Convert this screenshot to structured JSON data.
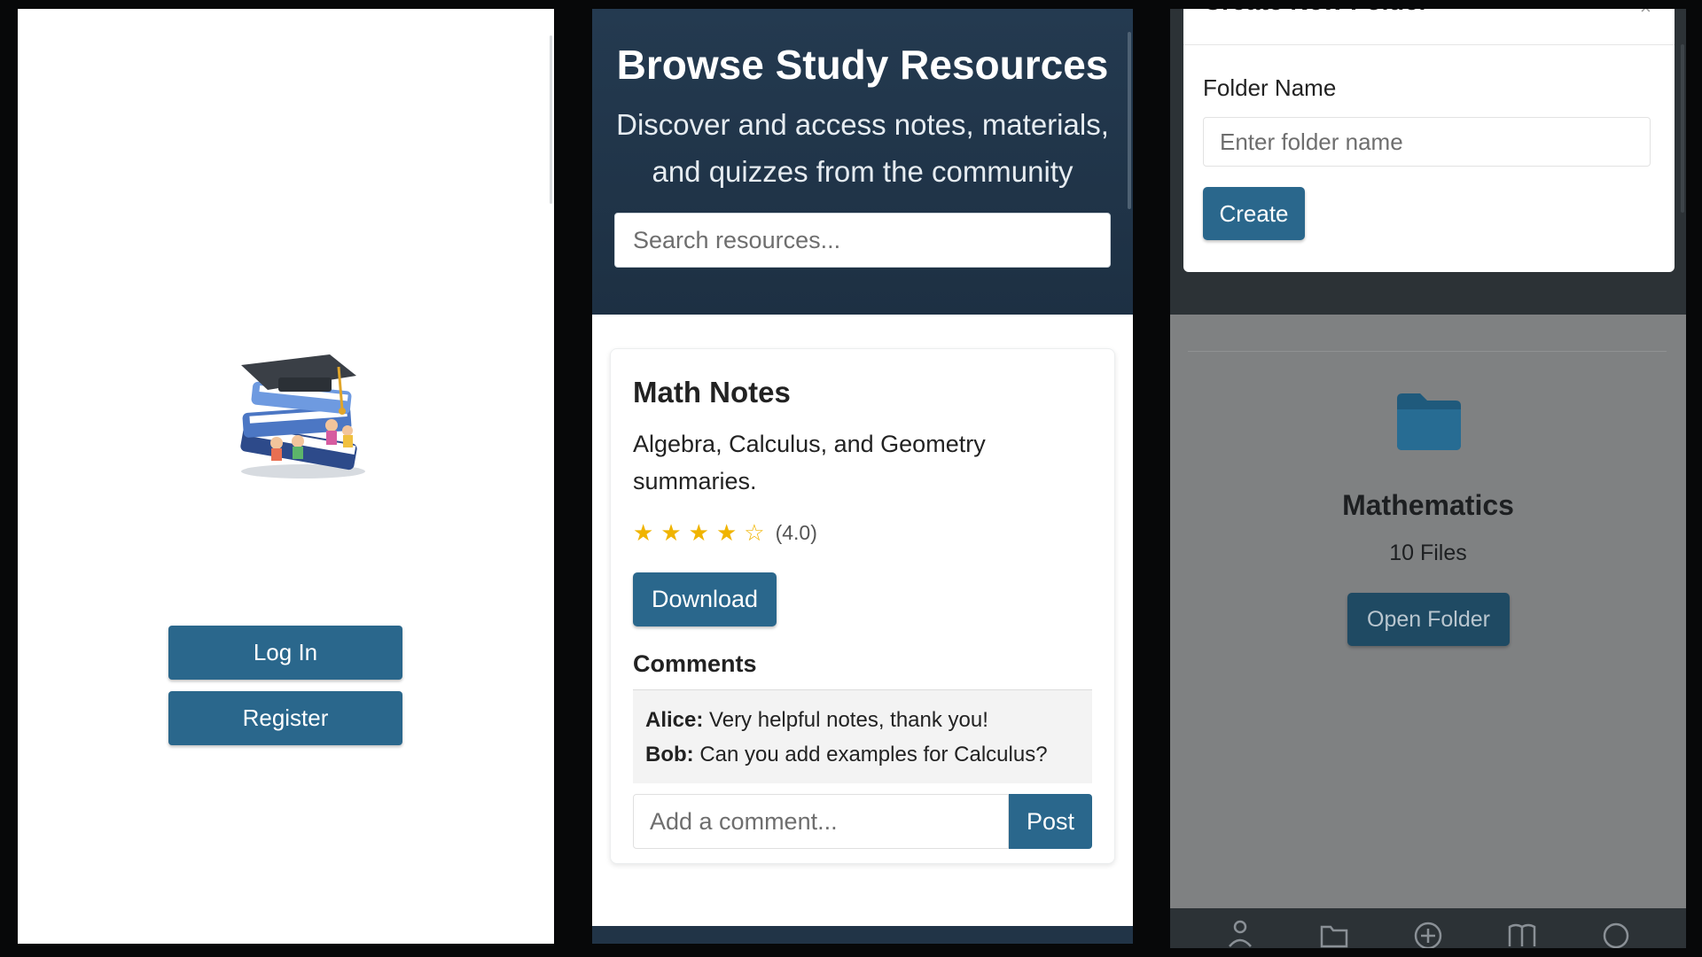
{
  "login_screen": {
    "login_label": "Log In",
    "register_label": "Register"
  },
  "browse_screen": {
    "title": "Browse Study Resources",
    "subtitle": "Discover and access notes, materials, and quizzes from the community",
    "search_placeholder": "Search resources...",
    "resource": {
      "title": "Math Notes",
      "description": "Algebra, Calculus, and Geometry summaries.",
      "rating_stars": 4,
      "rating_max": 5,
      "rating_text": "(4.0)",
      "download_label": "Download",
      "comments_heading": "Comments",
      "comments": [
        {
          "author": "Alice:",
          "text": "Very helpful notes, thank you!"
        },
        {
          "author": "Bob:",
          "text": "Can you add examples for Calculus?"
        }
      ],
      "comment_placeholder": "Add a comment...",
      "post_label": "Post"
    }
  },
  "folders_screen": {
    "modal": {
      "title": "Create New Folder",
      "close_symbol": "×",
      "field_label": "Folder Name",
      "field_placeholder": "Enter folder name",
      "create_label": "Create"
    },
    "folder": {
      "name": "Mathematics",
      "count": "10 Files",
      "open_label": "Open Folder"
    },
    "nav_icons": [
      "profile-icon",
      "folder-icon",
      "add-circle-icon",
      "library-icon",
      "search-icon"
    ]
  },
  "colors": {
    "primary_button": "#2a678c",
    "header_bg": "#243a50",
    "star": "#f0b400",
    "folder": "#2a678c"
  }
}
